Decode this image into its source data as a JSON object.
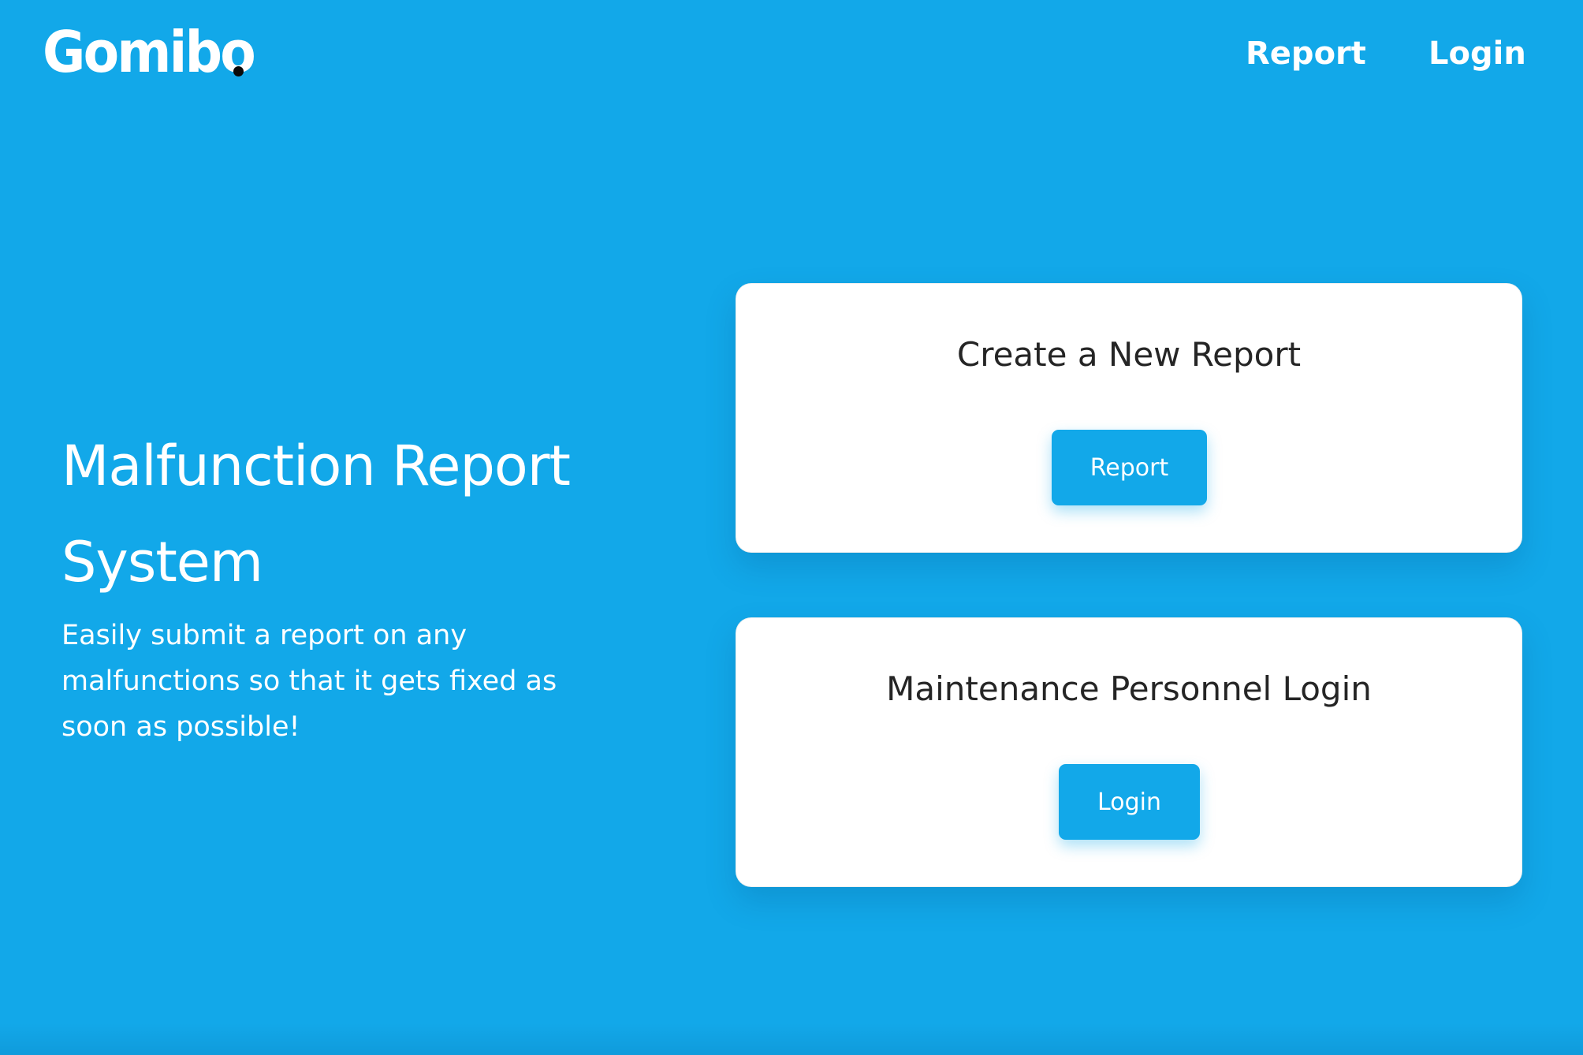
{
  "brand": {
    "name": "Gomibo"
  },
  "nav": {
    "report_label": "Report",
    "login_label": "Login"
  },
  "hero": {
    "title": "Malfunction Report System",
    "subtitle": "Easily submit a report on any malfunctions so that it gets fixed as soon as possible!"
  },
  "cards": [
    {
      "title": "Create a New Report",
      "button_label": "Report"
    },
    {
      "title": "Maintenance Personnel Login",
      "button_label": "Login"
    }
  ],
  "colors": {
    "background": "#12a8e9",
    "card_background": "#ffffff",
    "button": "#12a8e9",
    "heading_text": "#252525"
  }
}
